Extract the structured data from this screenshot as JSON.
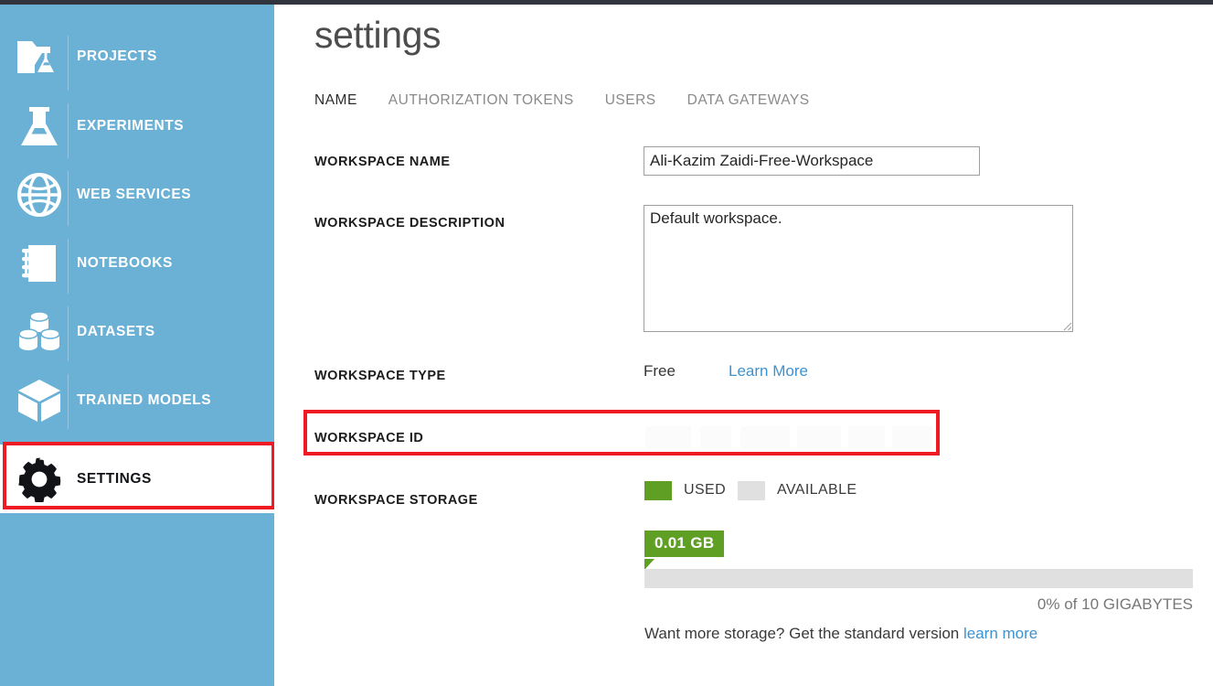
{
  "theme": {
    "sidebar_bg": "#6bb1d6",
    "topbar_bg": "#31353d",
    "annotation_red": "#ee1b24",
    "link_blue": "#3d92cf",
    "storage_used_green": "#5fa024",
    "storage_available_grey": "#e0e0e0"
  },
  "sidebar": {
    "items": [
      {
        "label": "PROJECTS",
        "icon": "folder-flask-icon",
        "active": false
      },
      {
        "label": "EXPERIMENTS",
        "icon": "flask-icon",
        "active": false
      },
      {
        "label": "WEB SERVICES",
        "icon": "globe-icon",
        "active": false
      },
      {
        "label": "NOTEBOOKS",
        "icon": "notebook-icon",
        "active": false
      },
      {
        "label": "DATASETS",
        "icon": "datasets-icon",
        "active": false
      },
      {
        "label": "TRAINED MODELS",
        "icon": "cube-icon",
        "active": false
      },
      {
        "label": "SETTINGS",
        "icon": "gear-icon",
        "active": true
      }
    ]
  },
  "header": {
    "title": "settings"
  },
  "tabs": [
    {
      "label": "NAME",
      "active": true
    },
    {
      "label": "AUTHORIZATION TOKENS",
      "active": false
    },
    {
      "label": "USERS",
      "active": false
    },
    {
      "label": "DATA GATEWAYS",
      "active": false
    }
  ],
  "form": {
    "workspace_name": {
      "label": "WORKSPACE NAME",
      "value": "Ali-Kazim Zaidi-Free-Workspace",
      "placeholder": ""
    },
    "workspace_description": {
      "label": "WORKSPACE DESCRIPTION",
      "value": "Default workspace.",
      "placeholder": ""
    },
    "workspace_type": {
      "label": "WORKSPACE TYPE",
      "value": "Free",
      "link_label": "Learn More"
    },
    "workspace_id": {
      "label": "WORKSPACE ID",
      "value": ""
    },
    "workspace_storage": {
      "label": "WORKSPACE STORAGE",
      "legend": [
        {
          "label": "USED",
          "color": "#5fa024"
        },
        {
          "label": "AVAILABLE",
          "color": "#e0e0e0"
        }
      ],
      "used_badge": "0.01 GB",
      "used_percent": 0,
      "capacity_caption": "0% of 10 GIGABYTES",
      "promo_text": "Want more storage? Get the standard version ",
      "promo_link": "learn more"
    }
  },
  "annotations": [
    {
      "name": "settings-nav-highlight"
    },
    {
      "name": "workspace-id-highlight"
    }
  ]
}
